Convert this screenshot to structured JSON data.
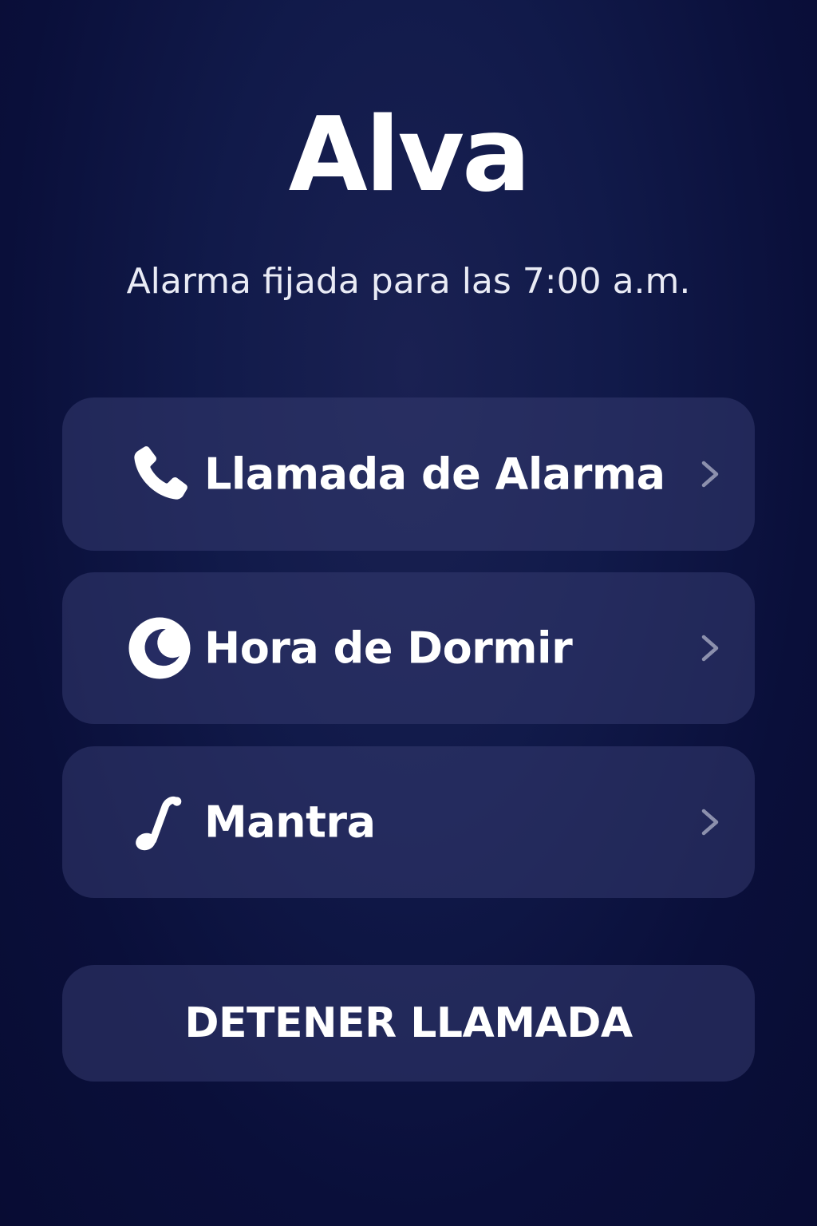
{
  "app": {
    "title": "Alva",
    "subtitle": "Alarma fijada para las 7:00 a.m."
  },
  "menu": {
    "items": [
      {
        "label": "Llamada de Alarma",
        "icon": "phone-icon"
      },
      {
        "label": "Hora de Dormir",
        "icon": "moon-icon"
      },
      {
        "label": "Mantra",
        "icon": "music-note-icon"
      }
    ]
  },
  "actions": {
    "stop_label": "DETENER LLAMADA"
  },
  "colors": {
    "background": "#0c1240",
    "card": "#262c63",
    "text": "#ffffff",
    "chevron": "#8c90ad"
  }
}
